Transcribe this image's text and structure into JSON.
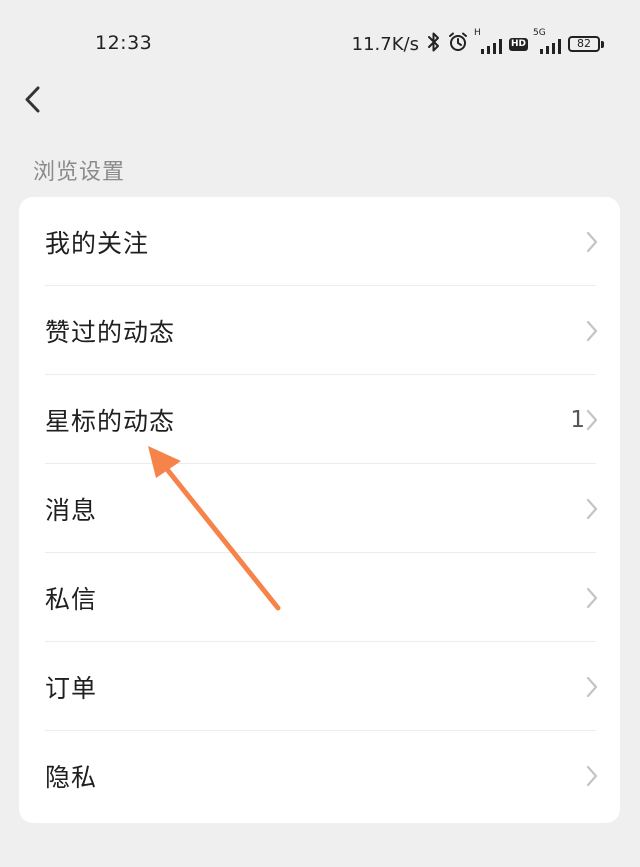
{
  "status_bar": {
    "time": "12:33",
    "net_speed": "11.7K/s",
    "signal1_label": "H",
    "hd_label": "HD",
    "signal2_label": "5G",
    "battery_level": "82"
  },
  "page": {
    "section_title": "浏览设置"
  },
  "menu": {
    "items": [
      {
        "label": "我的关注",
        "count": ""
      },
      {
        "label": "赞过的动态",
        "count": ""
      },
      {
        "label": "星标的动态",
        "count": "1"
      },
      {
        "label": "消息",
        "count": ""
      },
      {
        "label": "私信",
        "count": ""
      },
      {
        "label": "订单",
        "count": ""
      },
      {
        "label": "隐私",
        "count": ""
      }
    ]
  },
  "colors": {
    "background": "#efefef",
    "card": "#ffffff",
    "annotation_arrow": "#f5834a",
    "chevron": "#c4c4c4"
  }
}
